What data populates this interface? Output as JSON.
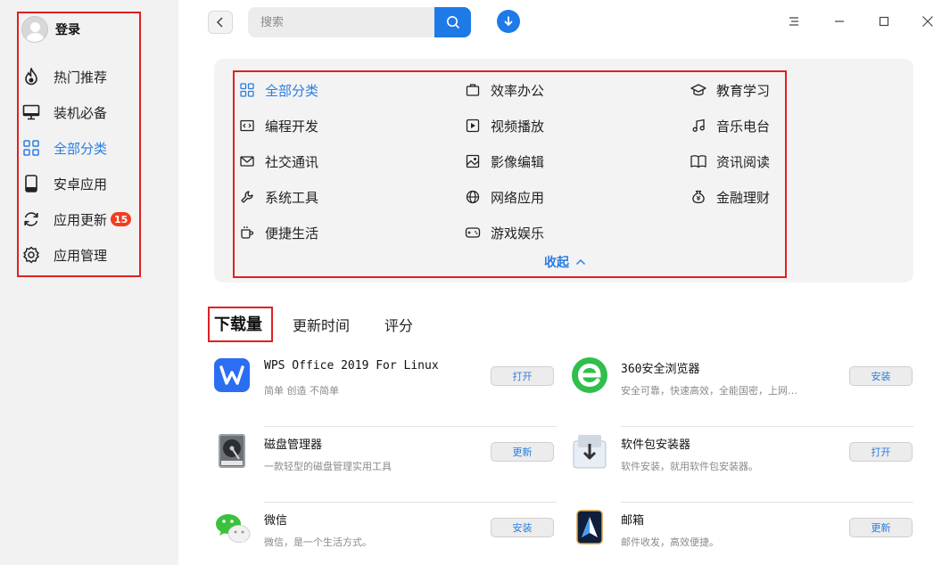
{
  "sidebar": {
    "user": {
      "label": "登录"
    },
    "items": [
      {
        "label": "热门推荐",
        "icon": "fire-icon"
      },
      {
        "label": "装机必备",
        "icon": "monitor-icon"
      },
      {
        "label": "全部分类",
        "icon": "grid-icon",
        "active": true
      },
      {
        "label": "安卓应用",
        "icon": "phone-icon"
      },
      {
        "label": "应用更新",
        "icon": "refresh-icon",
        "badge": "15"
      },
      {
        "label": "应用管理",
        "icon": "gear-icon"
      }
    ]
  },
  "topbar": {
    "search_placeholder": "搜索"
  },
  "categories": {
    "items": [
      {
        "label": "全部分类",
        "icon": "grid-icon"
      },
      {
        "label": "效率办公",
        "icon": "briefcase-icon"
      },
      {
        "label": "教育学习",
        "icon": "graduation-cap-icon"
      },
      {
        "label": "编程开发",
        "icon": "code-icon"
      },
      {
        "label": "视频播放",
        "icon": "play-icon"
      },
      {
        "label": "音乐电台",
        "icon": "music-note-icon"
      },
      {
        "label": "社交通讯",
        "icon": "mail-icon"
      },
      {
        "label": "影像编辑",
        "icon": "image-icon"
      },
      {
        "label": "资讯阅读",
        "icon": "book-icon"
      },
      {
        "label": "系统工具",
        "icon": "wrench-icon"
      },
      {
        "label": "网络应用",
        "icon": "globe-icon"
      },
      {
        "label": "金融理财",
        "icon": "money-bag-icon"
      },
      {
        "label": "便捷生活",
        "icon": "cup-icon"
      },
      {
        "label": "游戏娱乐",
        "icon": "gamepad-icon"
      }
    ],
    "collapse_label": "收起"
  },
  "sort_tabs": [
    {
      "label": "下载量",
      "active": true
    },
    {
      "label": "更新时间"
    },
    {
      "label": "评分"
    }
  ],
  "apps": [
    {
      "name": "WPS Office 2019 For Linux",
      "desc": "简单 创造 不简单",
      "action": "打开",
      "icon": "wps-icon"
    },
    {
      "name": "360安全浏览器",
      "desc": "安全可靠，快速高效，全能国密，上网…",
      "action": "安装",
      "icon": "browser-360-icon"
    },
    {
      "name": "磁盘管理器",
      "desc": "一款轻型的磁盘管理实用工具",
      "action": "更新",
      "icon": "disk-icon"
    },
    {
      "name": "软件包安装器",
      "desc": "软件安装，就用软件包安装器。",
      "action": "打开",
      "icon": "package-installer-icon"
    },
    {
      "name": "微信",
      "desc": "微信，是一个生活方式。",
      "action": "安装",
      "icon": "wechat-icon"
    },
    {
      "name": "邮箱",
      "desc": "邮件收发，高效便捷。",
      "action": "更新",
      "icon": "mail-app-icon"
    }
  ],
  "colors": {
    "accent": "#1e7ae6",
    "badge": "#f23c20",
    "highlight_border": "#e02020"
  }
}
